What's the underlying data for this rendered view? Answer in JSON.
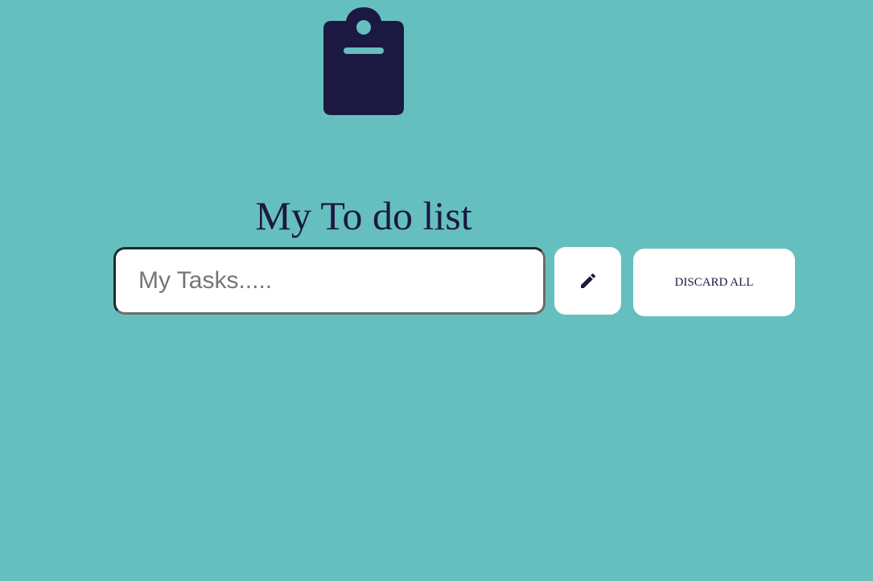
{
  "header": {
    "icon": "clipboard-icon",
    "title": "My To do list"
  },
  "task_form": {
    "input_value": "",
    "input_placeholder": "My Tasks.....",
    "add_button_icon": "pencil-icon",
    "discard_label": "DISCARD ALL"
  },
  "colors": {
    "background": "#66bfbf",
    "accent": "#1b1941",
    "button_background": "#ffffff"
  }
}
